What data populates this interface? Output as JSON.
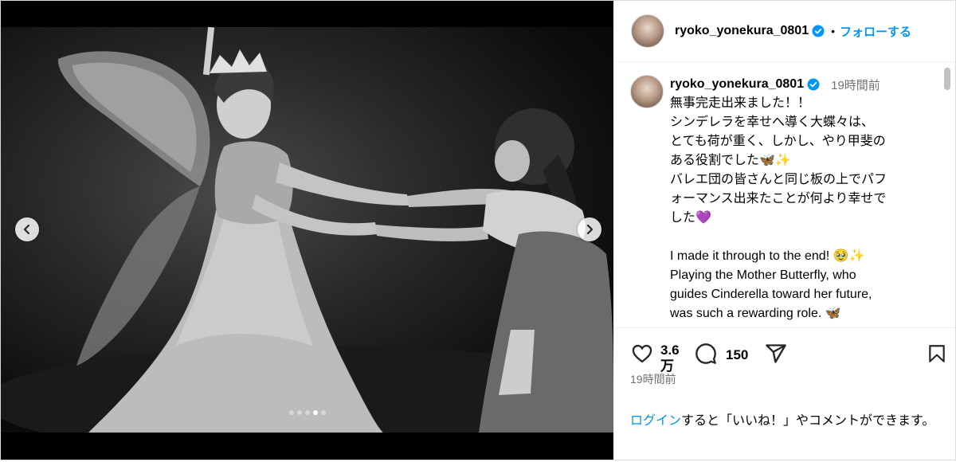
{
  "post": {
    "username": "ryoko_yonekura_0801",
    "follow_label": "フォローする",
    "separator": "•",
    "caption_time": "19時間前",
    "caption_text": "無事完走出来ました！！\nシンデレラを幸せへ導く大蝶々は、\nとても荷が重く、しかし、やり甲斐の\nある役割でした🦋✨\nバレエ団の皆さんと同じ板の上でパフ\nォーマンス出来たことが何より幸せで\nした💜\n\nI made it through to the end! 🥹✨\nPlaying the Mother Butterfly, who\nguides Cinderella toward her future,\nwas such a rewarding role. 🦋\nSharing the stage with all of you was",
    "likes_count": "3.6\n万",
    "comments_count": "150",
    "post_time": "19時間前",
    "login_link": "ログイン",
    "login_text": "すると「いいね！」やコメントができます。"
  },
  "carousel": {
    "total": 5,
    "active": 4
  },
  "colors": {
    "accent": "#0095f6",
    "muted": "#737373",
    "border": "#dbdbdb"
  },
  "icons": [
    "verified-badge-icon",
    "chevron-left-icon",
    "chevron-right-icon",
    "heart-icon",
    "comment-icon",
    "share-icon",
    "bookmark-icon"
  ]
}
